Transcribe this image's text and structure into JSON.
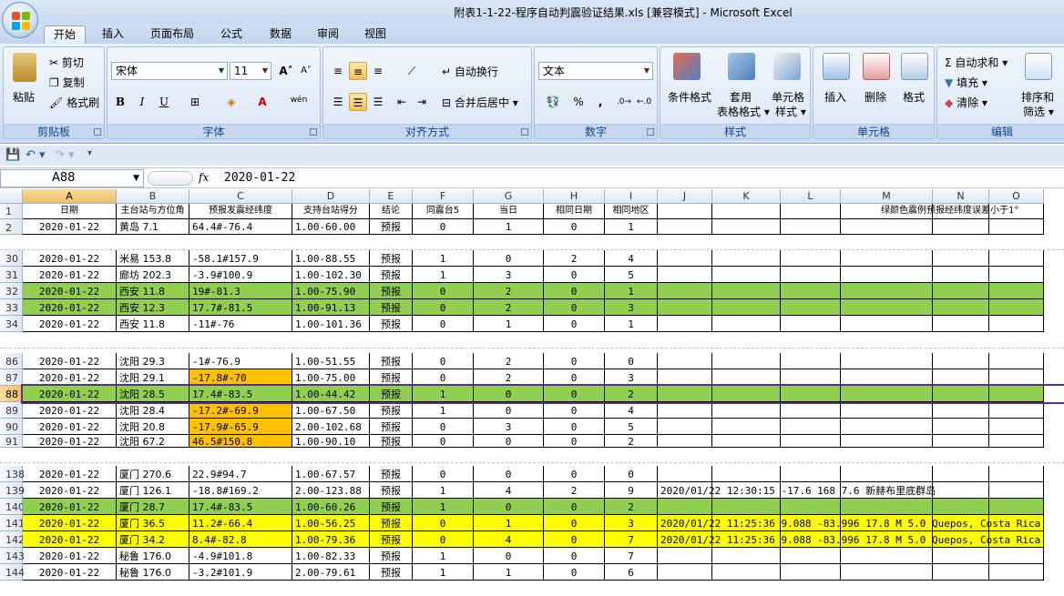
{
  "window": {
    "title": "附表1-1-22-程序自动判震验证结果.xls  [兼容模式] - Microsoft Excel"
  },
  "tabs": [
    "开始",
    "插入",
    "页面布局",
    "公式",
    "数据",
    "审阅",
    "视图"
  ],
  "ribbon": {
    "clipboard": {
      "paste": "粘贴",
      "cut": "剪切",
      "copy": "复制",
      "format_painter": "格式刷",
      "label": "剪贴板"
    },
    "font": {
      "name": "宋体",
      "size": "11",
      "grow": "A",
      "shrink": "A",
      "bold": "B",
      "italic": "I",
      "underline": "U",
      "label": "字体",
      "phonetic": "wén"
    },
    "alignment": {
      "wrap": "自动换行",
      "merge": "合并后居中",
      "label": "对齐方式"
    },
    "number": {
      "format": "文本",
      "percent": "%",
      "comma": ",",
      "label": "数字"
    },
    "styles": {
      "conditional": "条件格式",
      "table_l1": "套用",
      "table_l2": "表格格式",
      "cell_l1": "单元格",
      "cell_l2": "样式",
      "label": "样式"
    },
    "cells": {
      "insert": "插入",
      "delete": "删除",
      "format": "格式",
      "label": "单元格"
    },
    "editing": {
      "autosum": "自动求和",
      "fill": "填充",
      "clear": "清除",
      "sort_l1": "排序和",
      "sort_l2": "筛选",
      "label": "编辑"
    }
  },
  "formula_bar": {
    "name_box": "A88",
    "fx": "fx",
    "content": "2020-01-22"
  },
  "colors": {
    "green": "#92cf50",
    "yellow": "#ffff00",
    "orange": "#ffc000",
    "selection_border": "#5a2d8f"
  },
  "columns": [
    "A",
    "B",
    "C",
    "D",
    "E",
    "F",
    "G",
    "H",
    "I",
    "J",
    "K",
    "L",
    "M",
    "N",
    "O"
  ],
  "header_row": {
    "row": "1",
    "A": "日期",
    "B": "主台站与方位角",
    "C": "预报发震经纬度",
    "D": "支持台站得分",
    "E": "结论",
    "F": "同震台5",
    "G": "当日",
    "H": "相同日期",
    "I": "相同地区",
    "M": "绿颜色震例预报经纬度误差小于1°"
  },
  "rows": [
    {
      "row": "2",
      "A": "2020-01-22",
      "B": "黄岛 7.1",
      "C": "64.4#-76.4",
      "D": "1.00-60.00",
      "E": "预报",
      "F": "0",
      "G": "1",
      "H": "0",
      "I": "1",
      "fill": ""
    },
    {
      "row": "30",
      "A": "2020-01-22",
      "B": "米易 153.8",
      "C": "-58.1#157.9",
      "D": "1.00-88.55",
      "E": "预报",
      "F": "1",
      "G": "0",
      "H": "2",
      "I": "4",
      "fill": ""
    },
    {
      "row": "31",
      "A": "2020-01-22",
      "B": "廊坊 202.3",
      "C": "-3.9#100.9",
      "D": "1.00-102.30",
      "E": "预报",
      "F": "1",
      "G": "3",
      "H": "0",
      "I": "5",
      "fill": ""
    },
    {
      "row": "32",
      "A": "2020-01-22",
      "B": "西安 11.8",
      "C": "19#-81.3",
      "D": "1.00-75.90",
      "E": "预报",
      "F": "0",
      "G": "2",
      "H": "0",
      "I": "1",
      "fill": "green"
    },
    {
      "row": "33",
      "A": "2020-01-22",
      "B": "西安 12.3",
      "C": "17.7#-81.5",
      "D": "1.00-91.13",
      "E": "预报",
      "F": "0",
      "G": "2",
      "H": "0",
      "I": "3",
      "fill": "green"
    },
    {
      "row": "34",
      "A": "2020-01-22",
      "B": "西安 11.8",
      "C": "-11#-76",
      "D": "1.00-101.36",
      "E": "预报",
      "F": "0",
      "G": "1",
      "H": "0",
      "I": "1",
      "fill": ""
    },
    {
      "row": "86",
      "A": "2020-01-22",
      "B": "沈阳 29.3",
      "C": "-1#-76.9",
      "D": "1.00-51.55",
      "E": "预报",
      "F": "0",
      "G": "2",
      "H": "0",
      "I": "0",
      "fill": ""
    },
    {
      "row": "87",
      "A": "2020-01-22",
      "B": "沈阳 29.1",
      "C": "-17.8#-70",
      "D": "1.00-75.00",
      "E": "预报",
      "F": "0",
      "G": "2",
      "H": "0",
      "I": "3",
      "fill": "",
      "cfill": "orange"
    },
    {
      "row": "88",
      "A": "2020-01-22",
      "B": "沈阳 28.5",
      "C": "17.4#-83.5",
      "D": "1.00-44.42",
      "E": "预报",
      "F": "1",
      "G": "0",
      "H": "0",
      "I": "2",
      "fill": "green",
      "selected": true
    },
    {
      "row": "89",
      "A": "2020-01-22",
      "B": "沈阳 28.4",
      "C": "-17.2#-69.9",
      "D": "1.00-67.50",
      "E": "预报",
      "F": "1",
      "G": "0",
      "H": "0",
      "I": "4",
      "fill": "",
      "cfill": "orange"
    },
    {
      "row": "90",
      "A": "2020-01-22",
      "B": "沈阳 20.8",
      "C": "-17.9#-65.9",
      "D": "2.00-102.68",
      "E": "预报",
      "F": "0",
      "G": "3",
      "H": "0",
      "I": "5",
      "fill": "",
      "cfill": "orange"
    },
    {
      "row": "91",
      "A": "2020-01-22",
      "B": "沈阳 67.2",
      "C": "46.5#150.8",
      "D": "1.00-90.10",
      "E": "预报",
      "F": "0",
      "G": "0",
      "H": "0",
      "I": "2",
      "fill": "",
      "cfill": "orange"
    },
    {
      "row": "138",
      "A": "2020-01-22",
      "B": "厦门 270.6",
      "C": "22.9#94.7",
      "D": "1.00-67.57",
      "E": "预报",
      "F": "0",
      "G": "0",
      "H": "0",
      "I": "0",
      "fill": ""
    },
    {
      "row": "139",
      "A": "2020-01-22",
      "B": "厦门 126.1",
      "C": "-18.8#169.2",
      "D": "2.00-123.88",
      "E": "预报",
      "F": "1",
      "G": "4",
      "H": "2",
      "I": "9",
      "fill": "",
      "J": "2020/01/22 12:30:15 -17.6 168 7.6 新赫布里底群岛"
    },
    {
      "row": "140",
      "A": "2020-01-22",
      "B": "厦门 28.7",
      "C": "17.4#-83.5",
      "D": "1.00-60.26",
      "E": "预报",
      "F": "1",
      "G": "0",
      "H": "0",
      "I": "2",
      "fill": "green"
    },
    {
      "row": "141",
      "A": "2020-01-22",
      "B": "厦门 36.5",
      "C": "11.2#-66.4",
      "D": "1.00-56.25",
      "E": "预报",
      "F": "0",
      "G": "1",
      "H": "0",
      "I": "3",
      "fill": "yellow",
      "J": "2020/01/22 11:25:36 9.088 -83.996 17.8 M 5.0 Quepos, Costa Rica"
    },
    {
      "row": "142",
      "A": "2020-01-22",
      "B": "厦门 34.2",
      "C": "8.4#-82.8",
      "D": "1.00-79.36",
      "E": "预报",
      "F": "0",
      "G": "4",
      "H": "0",
      "I": "7",
      "fill": "yellow",
      "J": "2020/01/22 11:25:36 9.088 -83.996 17.8 M 5.0 Quepos, Costa Rica"
    },
    {
      "row": "143",
      "A": "2020-01-22",
      "B": "秘鲁 176.0",
      "C": "-4.9#101.8",
      "D": "1.00-82.33",
      "E": "预报",
      "F": "1",
      "G": "0",
      "H": "0",
      "I": "7",
      "fill": ""
    },
    {
      "row": "144",
      "A": "2020-01-22",
      "B": "秘鲁 176.0",
      "C": "-3.2#101.9",
      "D": "2.00-79.61",
      "E": "预报",
      "F": "1",
      "G": "1",
      "H": "0",
      "I": "6",
      "fill": ""
    }
  ]
}
